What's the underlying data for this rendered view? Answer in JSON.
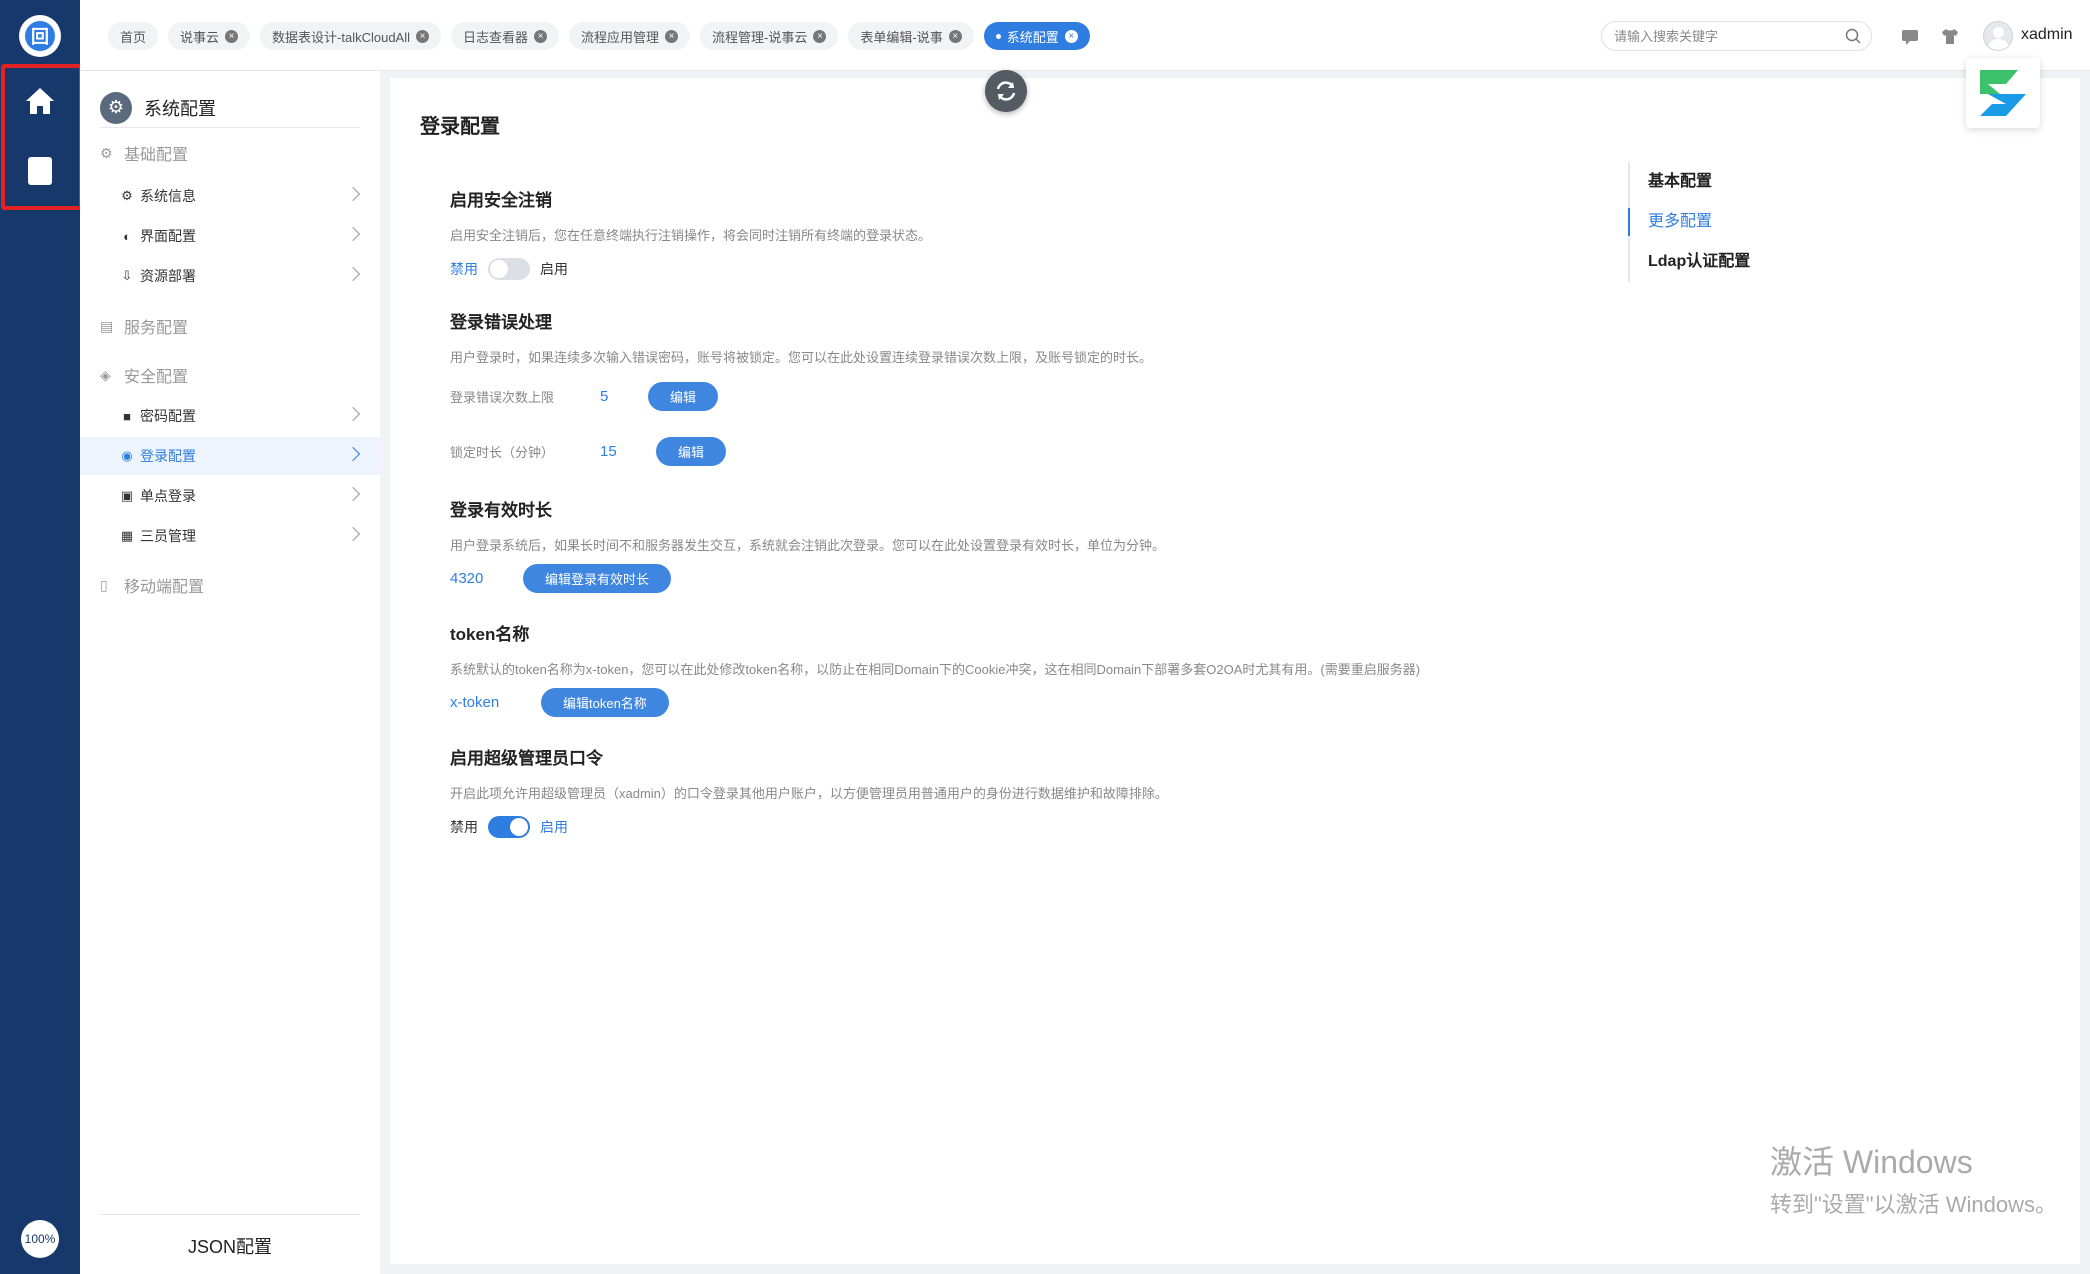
{
  "rail": {
    "zoom": "100%"
  },
  "tabs": [
    {
      "label": "首页"
    },
    {
      "label": "说事云"
    },
    {
      "label": "数据表设计-talkCloudAll"
    },
    {
      "label": "日志查看器"
    },
    {
      "label": "流程应用管理"
    },
    {
      "label": "流程管理-说事云"
    },
    {
      "label": "表单编辑-说事"
    },
    {
      "label": "系统配置"
    }
  ],
  "search": {
    "placeholder": "请输入搜索关键字"
  },
  "user": {
    "name": "xadmin"
  },
  "menu": {
    "title": "系统配置",
    "groups": {
      "basic": "基础配置",
      "service": "服务配置",
      "security": "安全配置",
      "mobile": "移动端配置"
    },
    "items": {
      "sysinfo": "系统信息",
      "ui": "界面配置",
      "deploy": "资源部署",
      "password": "密码配置",
      "login": "登录配置",
      "sso": "单点登录",
      "three": "三员管理"
    },
    "footer": "JSON配置"
  },
  "main": {
    "title": "登录配置",
    "safe_logout": {
      "title": "启用安全注销",
      "desc": "启用安全注销后，您在任意终端执行注销操作，将会同时注销所有终端的登录状态。",
      "off_label": "禁用",
      "on_label": "启用"
    },
    "login_error": {
      "title": "登录错误处理",
      "desc": "用户登录时，如果连续多次输入错误密码，账号将被锁定。您可以在此处设置连续登录错误次数上限，及账号锁定的时长。",
      "limit_label": "登录错误次数上限",
      "limit_value": "5",
      "lock_label": "锁定时长（分钟）",
      "lock_value": "15",
      "edit": "编辑"
    },
    "session": {
      "title": "登录有效时长",
      "desc": "用户登录系统后，如果长时间不和服务器发生交互，系统就会注销此次登录。您可以在此处设置登录有效时长，单位为分钟。",
      "value": "4320",
      "edit": "编辑登录有效时长"
    },
    "token": {
      "title": "token名称",
      "desc": "系统默认的token名称为x-token，您可以在此处修改token名称，以防止在相同Domain下的Cookie冲突，这在相同Domain下部署多套O2OA时尤其有用。(需要重启服务器)",
      "value": "x-token",
      "edit": "编辑token名称"
    },
    "super_admin": {
      "title": "启用超级管理员口令",
      "desc": "开启此项允许用超级管理员（xadmin）的口令登录其他用户账户，以方便管理员用普通用户的身份进行数据维护和故障排除。",
      "off_label": "禁用",
      "on_label": "启用"
    }
  },
  "anchors": [
    "基本配置",
    "更多配置",
    "Ldap认证配置"
  ],
  "watermark": {
    "line1": "激活 Windows",
    "line2": "转到\"设置\"以激活 Windows。"
  },
  "colors": {
    "rail": "#16386b",
    "accent": "#2f7de1",
    "highlight_border": "#e32222"
  }
}
